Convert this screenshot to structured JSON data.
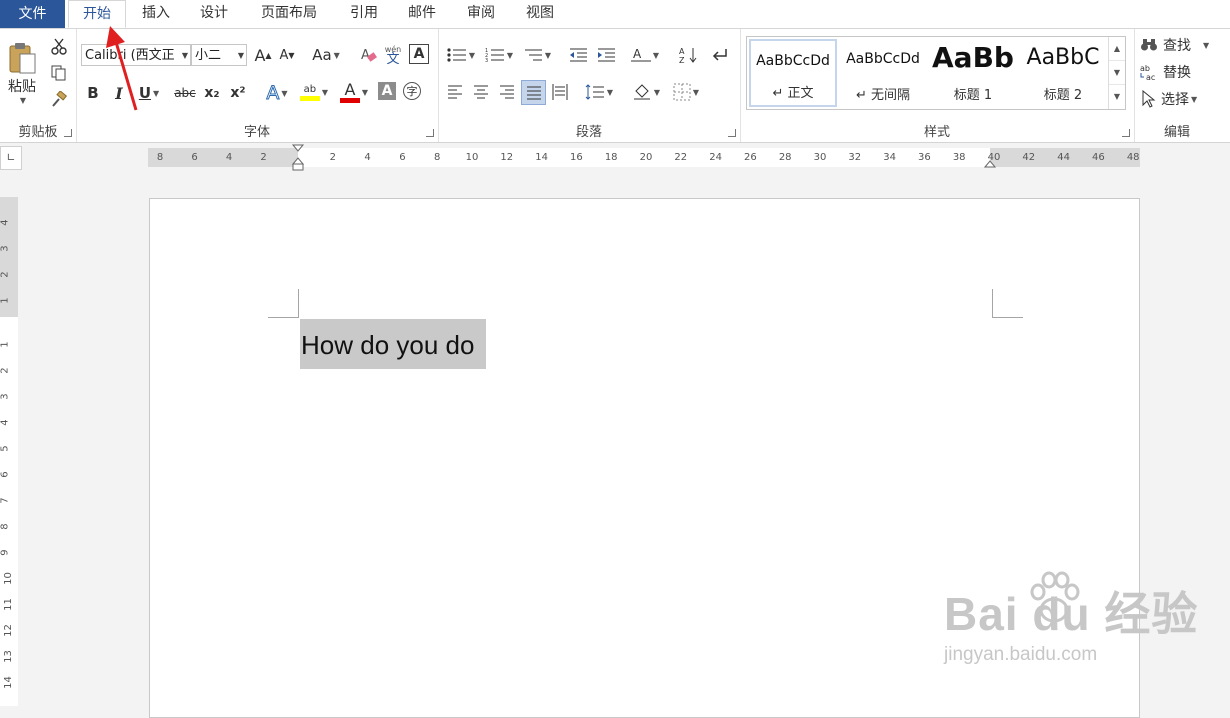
{
  "tabs": {
    "file": "文件",
    "items": [
      "开始",
      "插入",
      "设计",
      "页面布局",
      "引用",
      "邮件",
      "审阅",
      "视图"
    ]
  },
  "clipboard": {
    "paste_label": "粘贴",
    "group_label": "剪贴板"
  },
  "font": {
    "name": "Calibri (西文正",
    "size": "小二",
    "grow_label": "A",
    "shrink_label": "A",
    "case_label": "Aa",
    "phonetic_label": "wén",
    "phonetic_char": "文",
    "border_char": "A",
    "bold": "B",
    "italic": "I",
    "underline": "U",
    "strike": "abc",
    "subscript": "x₂",
    "superscript": "x²",
    "effects": "A",
    "highlight": "ab",
    "color": "A",
    "shading": "A",
    "enclose": "字",
    "group_label": "字体"
  },
  "paragraph": {
    "group_label": "段落"
  },
  "styles": {
    "items": [
      {
        "sample": "AaBbCcDd",
        "name": "↵ 正文"
      },
      {
        "sample": "AaBbCcDd",
        "name": "↵ 无间隔"
      },
      {
        "sample": "AaBb",
        "name": "标题 1"
      },
      {
        "sample": "AaBbC",
        "name": "标题 2"
      }
    ],
    "group_label": "样式"
  },
  "editing": {
    "find": "查找",
    "replace": "替换",
    "select": "选择",
    "group_label": "编辑"
  },
  "ruler": {
    "h_ticks": [
      "8",
      "6",
      "4",
      "2",
      "2",
      "4",
      "6",
      "8",
      "10",
      "12",
      "14",
      "16",
      "18",
      "20",
      "22",
      "24",
      "26",
      "28",
      "30",
      "32",
      "34",
      "36",
      "38",
      "40",
      "42",
      "44",
      "46",
      "48"
    ],
    "v_ticks": [
      "4",
      "3",
      "2",
      "1",
      "1",
      "2",
      "3",
      "4",
      "5",
      "6",
      "7",
      "8",
      "9",
      "10",
      "11",
      "12",
      "13",
      "14"
    ]
  },
  "document": {
    "text": "How do you do"
  },
  "watermark": {
    "big": "Bai du 经验",
    "small": "jingyan.baidu.com"
  },
  "colors": {
    "accent": "#2b579a",
    "highlight": "#ffff00",
    "font_color": "#e00000",
    "selection": "#c9c9c9",
    "annotation_arrow": "#e02020"
  }
}
